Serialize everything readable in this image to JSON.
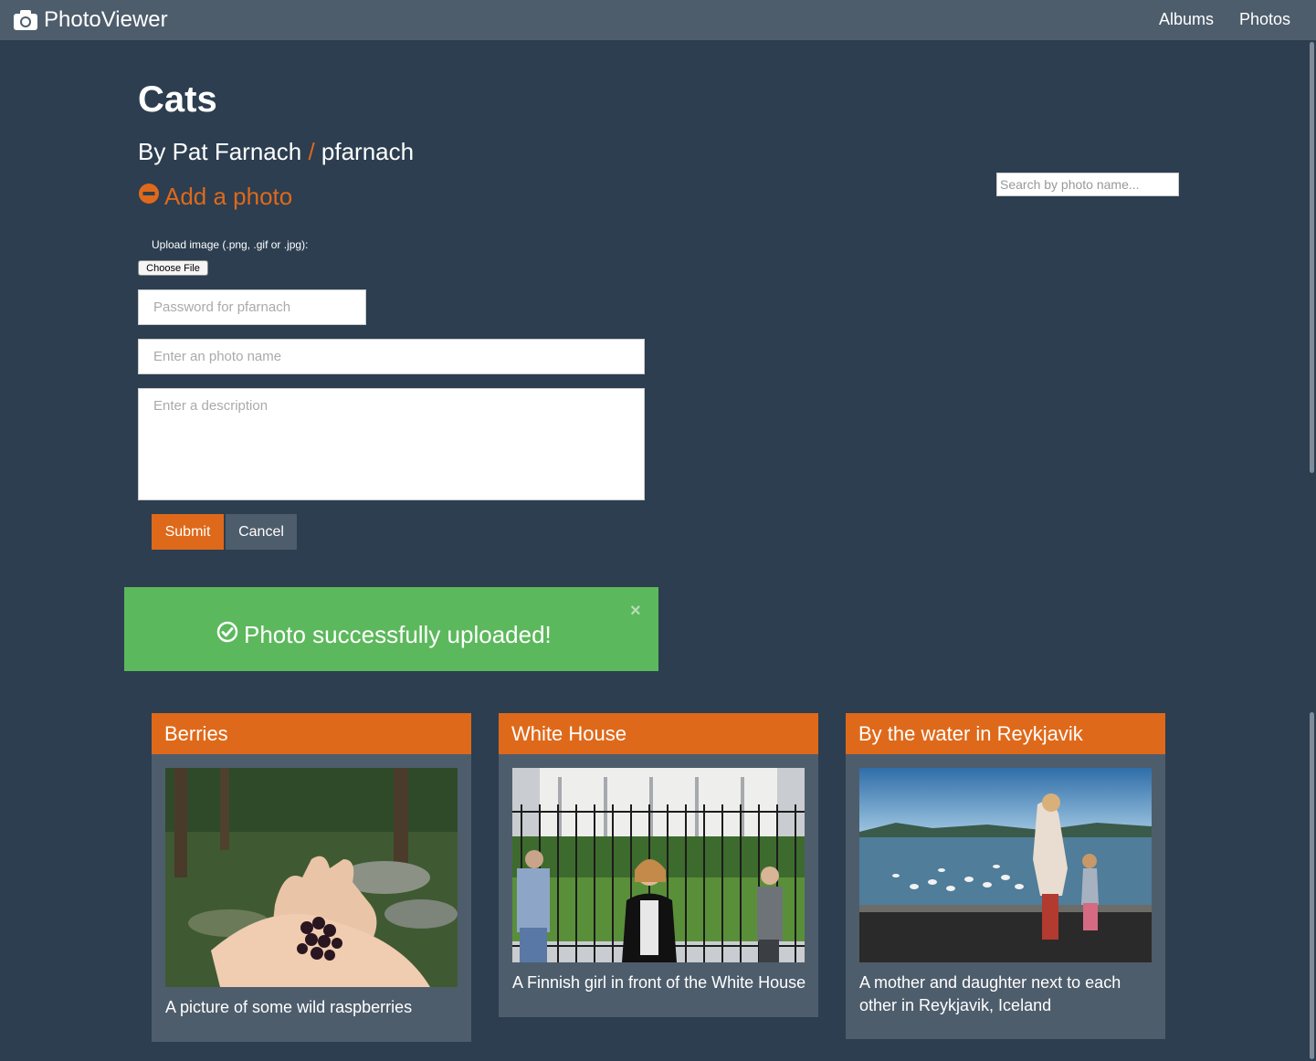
{
  "nav": {
    "brand": "PhotoViewer",
    "links": [
      "Albums",
      "Photos"
    ]
  },
  "album": {
    "title": "Cats",
    "by": "By Pat Farnach",
    "slash": "/",
    "username": "pfarnach",
    "add_photo": "Add a photo"
  },
  "search": {
    "placeholder": "Search by photo name..."
  },
  "form": {
    "upload_label": "Upload image (.png, .gif or .jpg):",
    "choose_file": "Choose File",
    "password_placeholder": "Password for pfarnach",
    "name_placeholder": "Enter an photo name",
    "description_placeholder": "Enter a description",
    "submit": "Submit",
    "cancel": "Cancel"
  },
  "alert": {
    "message": "Photo successfully uploaded!",
    "close": "×"
  },
  "photos": [
    {
      "name": "Berries",
      "description": "A picture of some wild raspberries"
    },
    {
      "name": "White House",
      "description": "A Finnish girl in front of the White House"
    },
    {
      "name": "By the water in Reykjavik",
      "description": "A mother and daughter next to each other in Reykjavik, Iceland"
    }
  ],
  "colors": {
    "background": "#2c3e50",
    "navbar": "#4e5d6c",
    "accent": "#df691a",
    "success": "#5cb85c"
  }
}
